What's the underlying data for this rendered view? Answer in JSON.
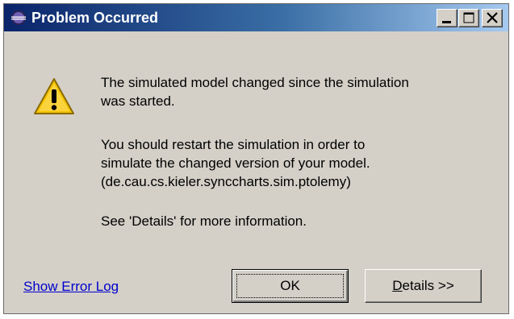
{
  "window": {
    "title": "Problem Occurred",
    "controls": {
      "minimize": "minimize",
      "maximize": "maximize",
      "close": "close"
    }
  },
  "message": {
    "paragraph1": [
      "The simulated model changed since the simulation",
      "was started."
    ],
    "paragraph2": [
      "You should restart the simulation in order to",
      "simulate the changed version of your model.",
      "(de.cau.cs.kieler.synccharts.sim.ptolemy)"
    ],
    "paragraph3": [
      "See 'Details' for more information."
    ]
  },
  "footer": {
    "link_label": "Show Error Log",
    "ok_label": "OK",
    "details_mnemonic": "D",
    "details_rest": "etails >>"
  },
  "icons": {
    "app": "eclipse-icon",
    "warning": "warning-icon"
  },
  "colors": {
    "title_gradient_start": "#0a246a",
    "title_gradient_end": "#a6caf0",
    "dialog_bg": "#d4d0c8",
    "link": "#0000cc",
    "warning_fill": "#f5c400"
  }
}
